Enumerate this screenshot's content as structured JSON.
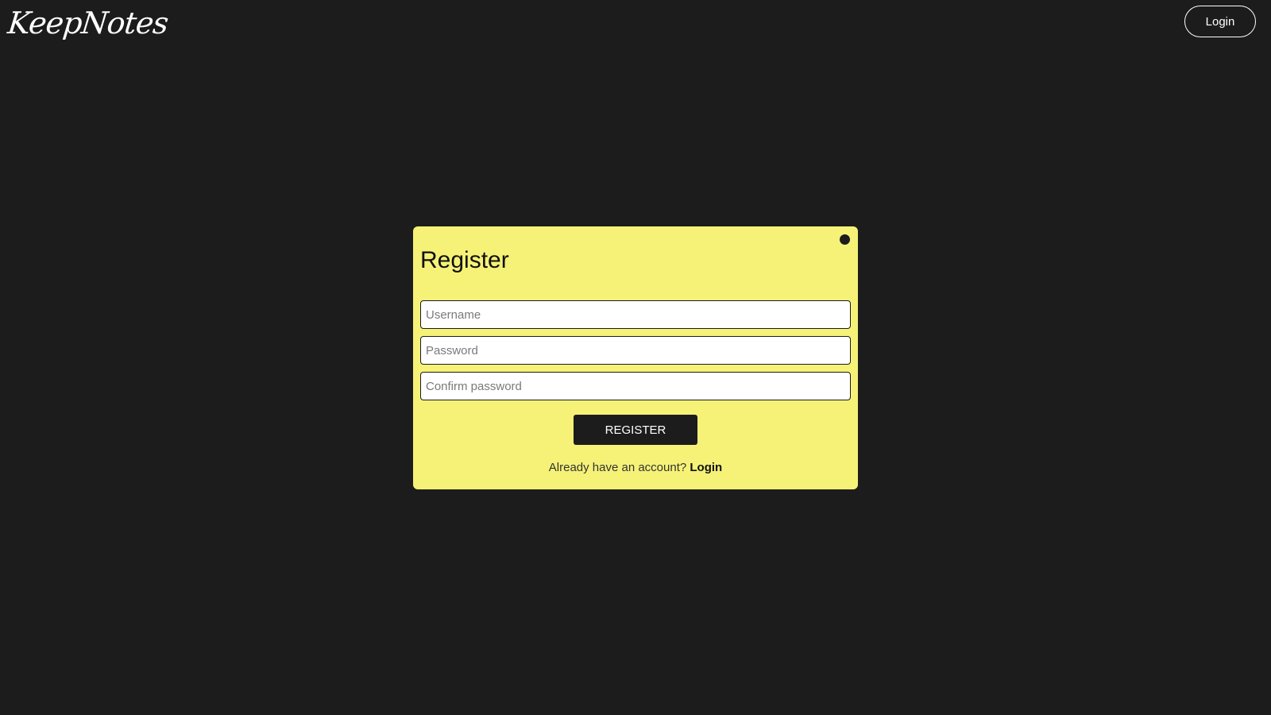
{
  "header": {
    "logo": "KeepNotes",
    "login_label": "Login"
  },
  "register_form": {
    "title": "Register",
    "username_placeholder": "Username",
    "password_placeholder": "Password",
    "confirm_placeholder": "Confirm password",
    "submit_label": "REGISTER",
    "footer_text": "Already have an account?",
    "footer_link": "Login"
  },
  "colors": {
    "background": "#1c1c1c",
    "card": "#f6f277",
    "button": "#1c1c1c"
  },
  "icons": {
    "close": "close-dot-icon"
  }
}
